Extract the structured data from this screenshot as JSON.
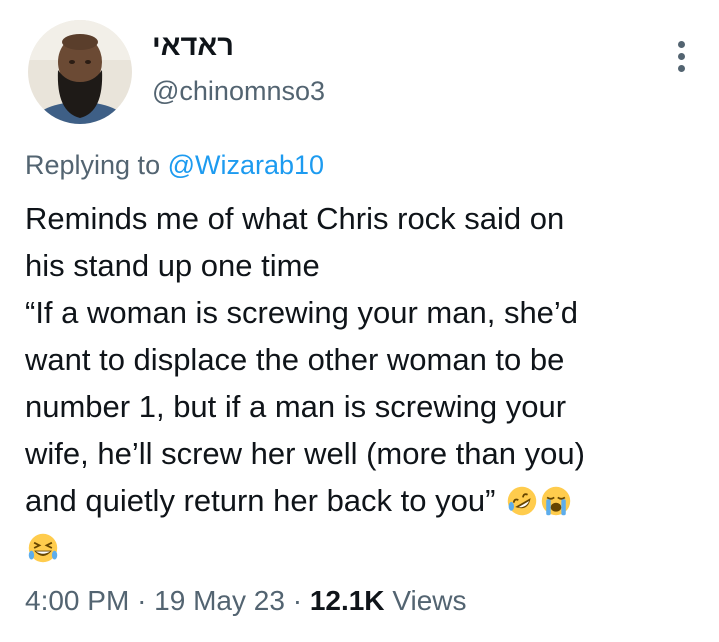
{
  "author": {
    "display_name": "ראדאי",
    "handle": "@chinomnso3",
    "avatar": "profile-photo"
  },
  "more_icon": "more-options-icon",
  "reply": {
    "prefix": "Replying to",
    "mention": "@Wizarab10"
  },
  "tweet": {
    "lines": [
      "Reminds me of what Chris rock said on",
      "his stand up one time",
      "“If a woman is screwing your man, she’d",
      "want to displace the other woman to be",
      "number 1, but if a man is screwing your",
      "wife, he’ll screw her well (more than you)",
      "and quietly return her back to you”"
    ],
    "emojis": [
      "rolling-on-floor-laughing-emoji",
      "loudly-crying-emoji",
      "grinning-squinting-sweat-emoji"
    ]
  },
  "meta": {
    "time": "4:00 PM",
    "separator": "·",
    "date": "19 May 23",
    "views_count": "12.1K",
    "views_label": "Views"
  },
  "colors": {
    "text": "#0f1419",
    "secondary": "#536471",
    "link": "#1d9bf0",
    "background": "#ffffff"
  }
}
